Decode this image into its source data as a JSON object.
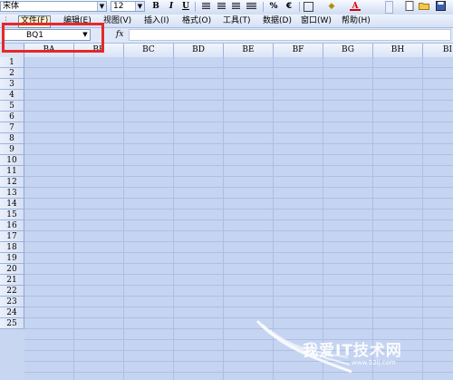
{
  "toolbar": {
    "font_name": "宋体",
    "font_size": "12",
    "bold": "B",
    "italic": "I",
    "underline": "U",
    "percent": "%",
    "currency": "€",
    "font_color_letter": "A"
  },
  "menubar": {
    "items": [
      {
        "label": "文件(F)"
      },
      {
        "label": "编辑(E)"
      },
      {
        "label": "视图(V)"
      },
      {
        "label": "插入(I)"
      },
      {
        "label": "格式(O)"
      },
      {
        "label": "工具(T)"
      },
      {
        "label": "数据(D)"
      },
      {
        "label": "窗口(W)"
      },
      {
        "label": "帮助(H)"
      }
    ]
  },
  "formula_bar": {
    "name_box_value": "BQ1",
    "fx_label": "fx",
    "formula_value": ""
  },
  "grid": {
    "columns": [
      "BA",
      "BB",
      "BC",
      "BD",
      "BE",
      "BF",
      "BG",
      "BH",
      "BI"
    ],
    "rows": [
      "1",
      "2",
      "3",
      "4",
      "5",
      "6",
      "7",
      "8",
      "9",
      "10",
      "11",
      "12",
      "13",
      "14",
      "15",
      "16",
      "17",
      "18",
      "19",
      "20",
      "21",
      "22",
      "23",
      "24",
      "25"
    ]
  },
  "watermark": {
    "text": "我爱IT技术网",
    "url": "www.52ij.com"
  },
  "colors": {
    "highlight": "#e5282a",
    "cell_selection": "#c5d4f1"
  }
}
